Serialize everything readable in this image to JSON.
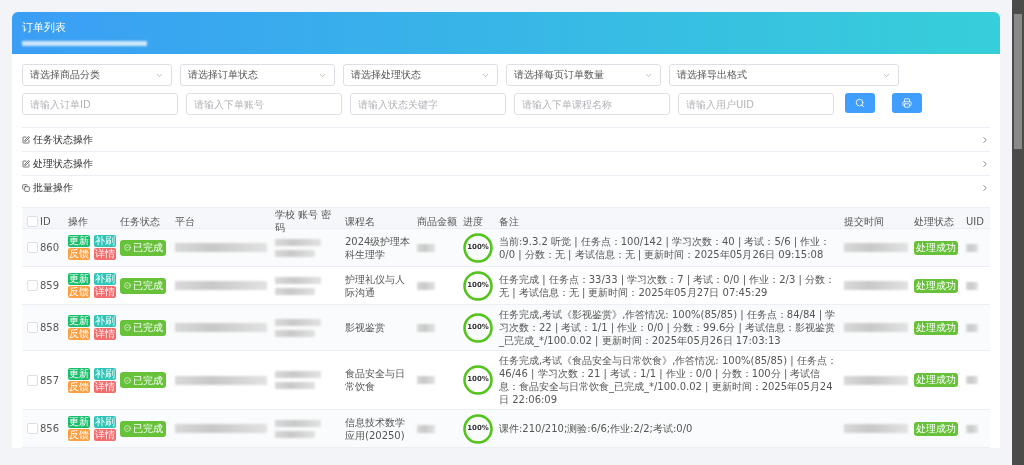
{
  "header": {
    "title": "订单列表"
  },
  "filters": {
    "selects": [
      {
        "placeholder": "请选择商品分类"
      },
      {
        "placeholder": "请选择订单状态"
      },
      {
        "placeholder": "请选择处理状态"
      },
      {
        "placeholder": "请选择每页订单数量"
      },
      {
        "placeholder": "请选择导出格式"
      }
    ],
    "inputs": [
      {
        "placeholder": "请输入订单ID"
      },
      {
        "placeholder": "请输入下单账号"
      },
      {
        "placeholder": "请输入状态关键字"
      },
      {
        "placeholder": "请输入下单课程名称"
      },
      {
        "placeholder": "请输入用户UID"
      }
    ]
  },
  "sections": [
    {
      "kind": "edit",
      "label": "任务状态操作"
    },
    {
      "kind": "edit",
      "label": "处理状态操作"
    },
    {
      "kind": "batch",
      "label": "批量操作"
    }
  ],
  "table": {
    "select_all_checked": false,
    "columns": [
      "ID",
      "操作",
      "任务状态",
      "平台",
      "学校 账号 密码",
      "课程名",
      "商品金额",
      "进度",
      "备注",
      "提交时间",
      "处理状态",
      "UID"
    ],
    "rows": [
      {
        "checked": false,
        "id": "860",
        "actions": [
          "更新",
          "补刷",
          "反馈",
          "详情"
        ],
        "task_status": "已完成",
        "course": "2024级护理本科生理学",
        "progress": {
          "level": 1,
          "label": "100%"
        },
        "note": "当前:9.3.2 听觉 | 任务点：100/142 | 学习次数：40 | 考试：5/6 | 作业：0/0 | 分数：无 | 考试信息：无 | 更新时间：2025年05月26日 09:15:08",
        "process_status": "处理成功"
      },
      {
        "checked": false,
        "id": "859",
        "actions": [
          "更新",
          "补刷",
          "反馈",
          "详情"
        ],
        "task_status": "已完成",
        "course": "护理礼仪与人际沟通",
        "progress": {
          "level": 1,
          "label": "100%"
        },
        "note": "任务完成 | 任务点：33/33 | 学习次数：7 | 考试：0/0 | 作业：2/3 | 分数：无 | 考试信息：无 | 更新时间：2025年05月27日 07:45:29",
        "process_status": "处理成功"
      },
      {
        "checked": false,
        "id": "858",
        "actions": [
          "更新",
          "补刷",
          "反馈",
          "详情"
        ],
        "task_status": "已完成",
        "course": "影视鉴赏",
        "progress": {
          "level": 1,
          "label": "100%"
        },
        "note": "任务完成,考试《影视鉴赏》,作答情况: 100%(85/85) | 任务点：84/84 | 学习次数：22 | 考试：1/1 | 作业：0/0 | 分数：99.6分 | 考试信息：影视鉴赏_已完成_*/100.0.02 | 更新时间：2025年05月26日 17:03:13",
        "process_status": "处理成功"
      },
      {
        "checked": false,
        "id": "857",
        "actions": [
          "更新",
          "补刷",
          "反馈",
          "详情"
        ],
        "task_status": "已完成",
        "course": "食品安全与日常饮食",
        "progress": {
          "level": 1,
          "label": "100%"
        },
        "note": "任务完成,考试《食品安全与日常饮食》,作答情况: 100%(85/85) | 任务点：46/46 | 学习次数：21 | 考试：1/1 | 作业：0/0 | 分数：100分 | 考试信息：食品安全与日常饮食_已完成_*/100.0.02 | 更新时间：2025年05月24日 22:06:09",
        "process_status": "处理成功"
      },
      {
        "checked": false,
        "id": "856",
        "actions": [
          "更新",
          "补刷",
          "反馈",
          "详情"
        ],
        "task_status": "已完成",
        "course": "信息技术数学应用(20250)",
        "progress": {
          "level": 1,
          "label": "100%"
        },
        "note": "课件:210/210;测验:6/6;作业:2/2;考试:0/0",
        "process_status": "处理成功"
      }
    ]
  }
}
